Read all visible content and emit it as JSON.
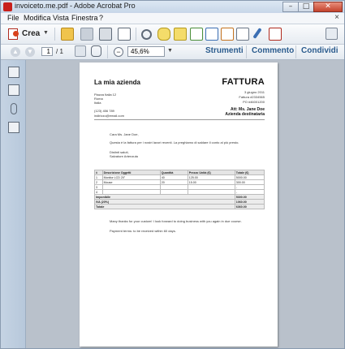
{
  "window": {
    "title": "invoiceto.me.pdf - Adobe Acrobat Pro",
    "controls": {
      "minimize": "–",
      "maximize": "□",
      "close": "✕"
    }
  },
  "menu": {
    "items": [
      "File",
      "Modifica",
      "Vista",
      "Finestra",
      "?"
    ],
    "close": "×"
  },
  "toolbar": {
    "create_label": "Crea",
    "page_current": "1",
    "page_total": "/ 1",
    "zoom": "45,6%",
    "panels": [
      "Strumenti",
      "Commento",
      "Condividi"
    ]
  },
  "document": {
    "company_name": "La mia azienda",
    "doc_title": "FATTURA",
    "address_lines": [
      "Piazza Italia 12",
      "Roma",
      "Italia"
    ],
    "phone": "(123) 456 789",
    "email": "indirizzo@email.com",
    "date": "3 giugno 2011",
    "invoice_no": "Fattura #2334565",
    "po": "PO #46001200",
    "attn": "Att: Ms. Jane Doe",
    "recipient_company": "Azienda destinataria",
    "greeting": "Cara Ms. Jane Doe,",
    "intro": "Questa è la fattura per i nostri lavori recenti. La preghiamo di saldare il conto al più presto.",
    "regards": "Distinti saluti,",
    "signer": "Salvatore Artenzuta",
    "table": {
      "headers": [
        "#",
        "Descrizione Oggetti",
        "Quantità",
        "Prezzo Unità (€)",
        "Totale (€)"
      ],
      "rows": [
        [
          "1",
          "Monitor LCD 20\"",
          "40",
          "125.00",
          "5000.00"
        ],
        [
          "2",
          "Mouse",
          "20",
          "15.00",
          "300.00"
        ],
        [
          "3",
          "",
          "",
          "",
          "-"
        ],
        [
          "4",
          "",
          "",
          "",
          "-"
        ]
      ],
      "summary": [
        [
          "Imponibile",
          "5300.00"
        ],
        [
          "IVA (20%)",
          "1060.00"
        ],
        [
          "Totale",
          "6360.00"
        ]
      ]
    },
    "thanks": "Many thanks for your custom! I look forward to doing business with you again in due course.",
    "terms": "Payment terms: to be received within 60 days."
  }
}
